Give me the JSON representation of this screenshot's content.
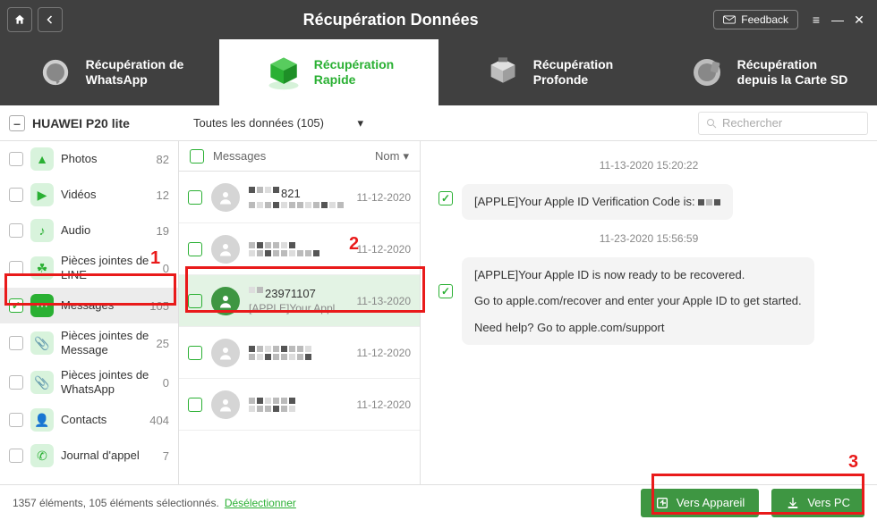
{
  "title": "Récupération Données",
  "feedback_label": "Feedback",
  "modes": [
    {
      "label": "Récupération de\nWhatsApp"
    },
    {
      "label": "Récupération\nRapide"
    },
    {
      "label": "Récupération\nProfonde"
    },
    {
      "label": "Récupération\ndepuis la Carte SD"
    }
  ],
  "device_name": "HUAWEI P20 lite",
  "filter_label": "Toutes les données (105)",
  "search_placeholder": "Rechercher",
  "categories": [
    {
      "name": "Photos",
      "count": 82
    },
    {
      "name": "Vidéos",
      "count": 12
    },
    {
      "name": "Audio",
      "count": 19
    },
    {
      "name": "Pièces jointes de LINE",
      "count": 0
    },
    {
      "name": "Messages",
      "count": 105,
      "checked": true,
      "selected": true
    },
    {
      "name": "Pièces jointes de Message",
      "count": 25
    },
    {
      "name": "Pièces jointes de WhatsApp",
      "count": 0
    },
    {
      "name": "Contacts",
      "count": 404
    },
    {
      "name": "Journal d'appel",
      "count": 7
    }
  ],
  "list_header": {
    "title": "Messages",
    "sort": "Nom"
  },
  "threads": [
    {
      "line1_suffix": "821",
      "line2": "",
      "date": "11-12-2020"
    },
    {
      "line1_suffix": "",
      "line2": "",
      "date": "11-12-2020"
    },
    {
      "line1_suffix": "23971107",
      "line2": "[APPLE]Your Apple ID i...",
      "date": "11-13-2020",
      "highlight": true
    },
    {
      "line1_suffix": "",
      "line2": "",
      "date": "11-12-2020"
    },
    {
      "line1_suffix": "",
      "line2": "",
      "date": "11-12-2020"
    }
  ],
  "preview": {
    "stamp1": "11-13-2020 15:20:22",
    "msg1": "[APPLE]Your Apple ID Verification Code is:",
    "stamp2": "11-23-2020 15:56:59",
    "msg2a": "[APPLE]Your Apple ID is now ready to be recovered.",
    "msg2b": "Go to apple.com/recover and enter your Apple ID to get started.",
    "msg2c": "Need help? Go to apple.com/support"
  },
  "footer": {
    "summary": "1357 éléments, 105 éléments sélectionnés.",
    "deselect": "Désélectionner",
    "to_device": "Vers Appareil",
    "to_pc": "Vers PC"
  },
  "anno": {
    "n1": "1",
    "n2": "2",
    "n3": "3"
  }
}
